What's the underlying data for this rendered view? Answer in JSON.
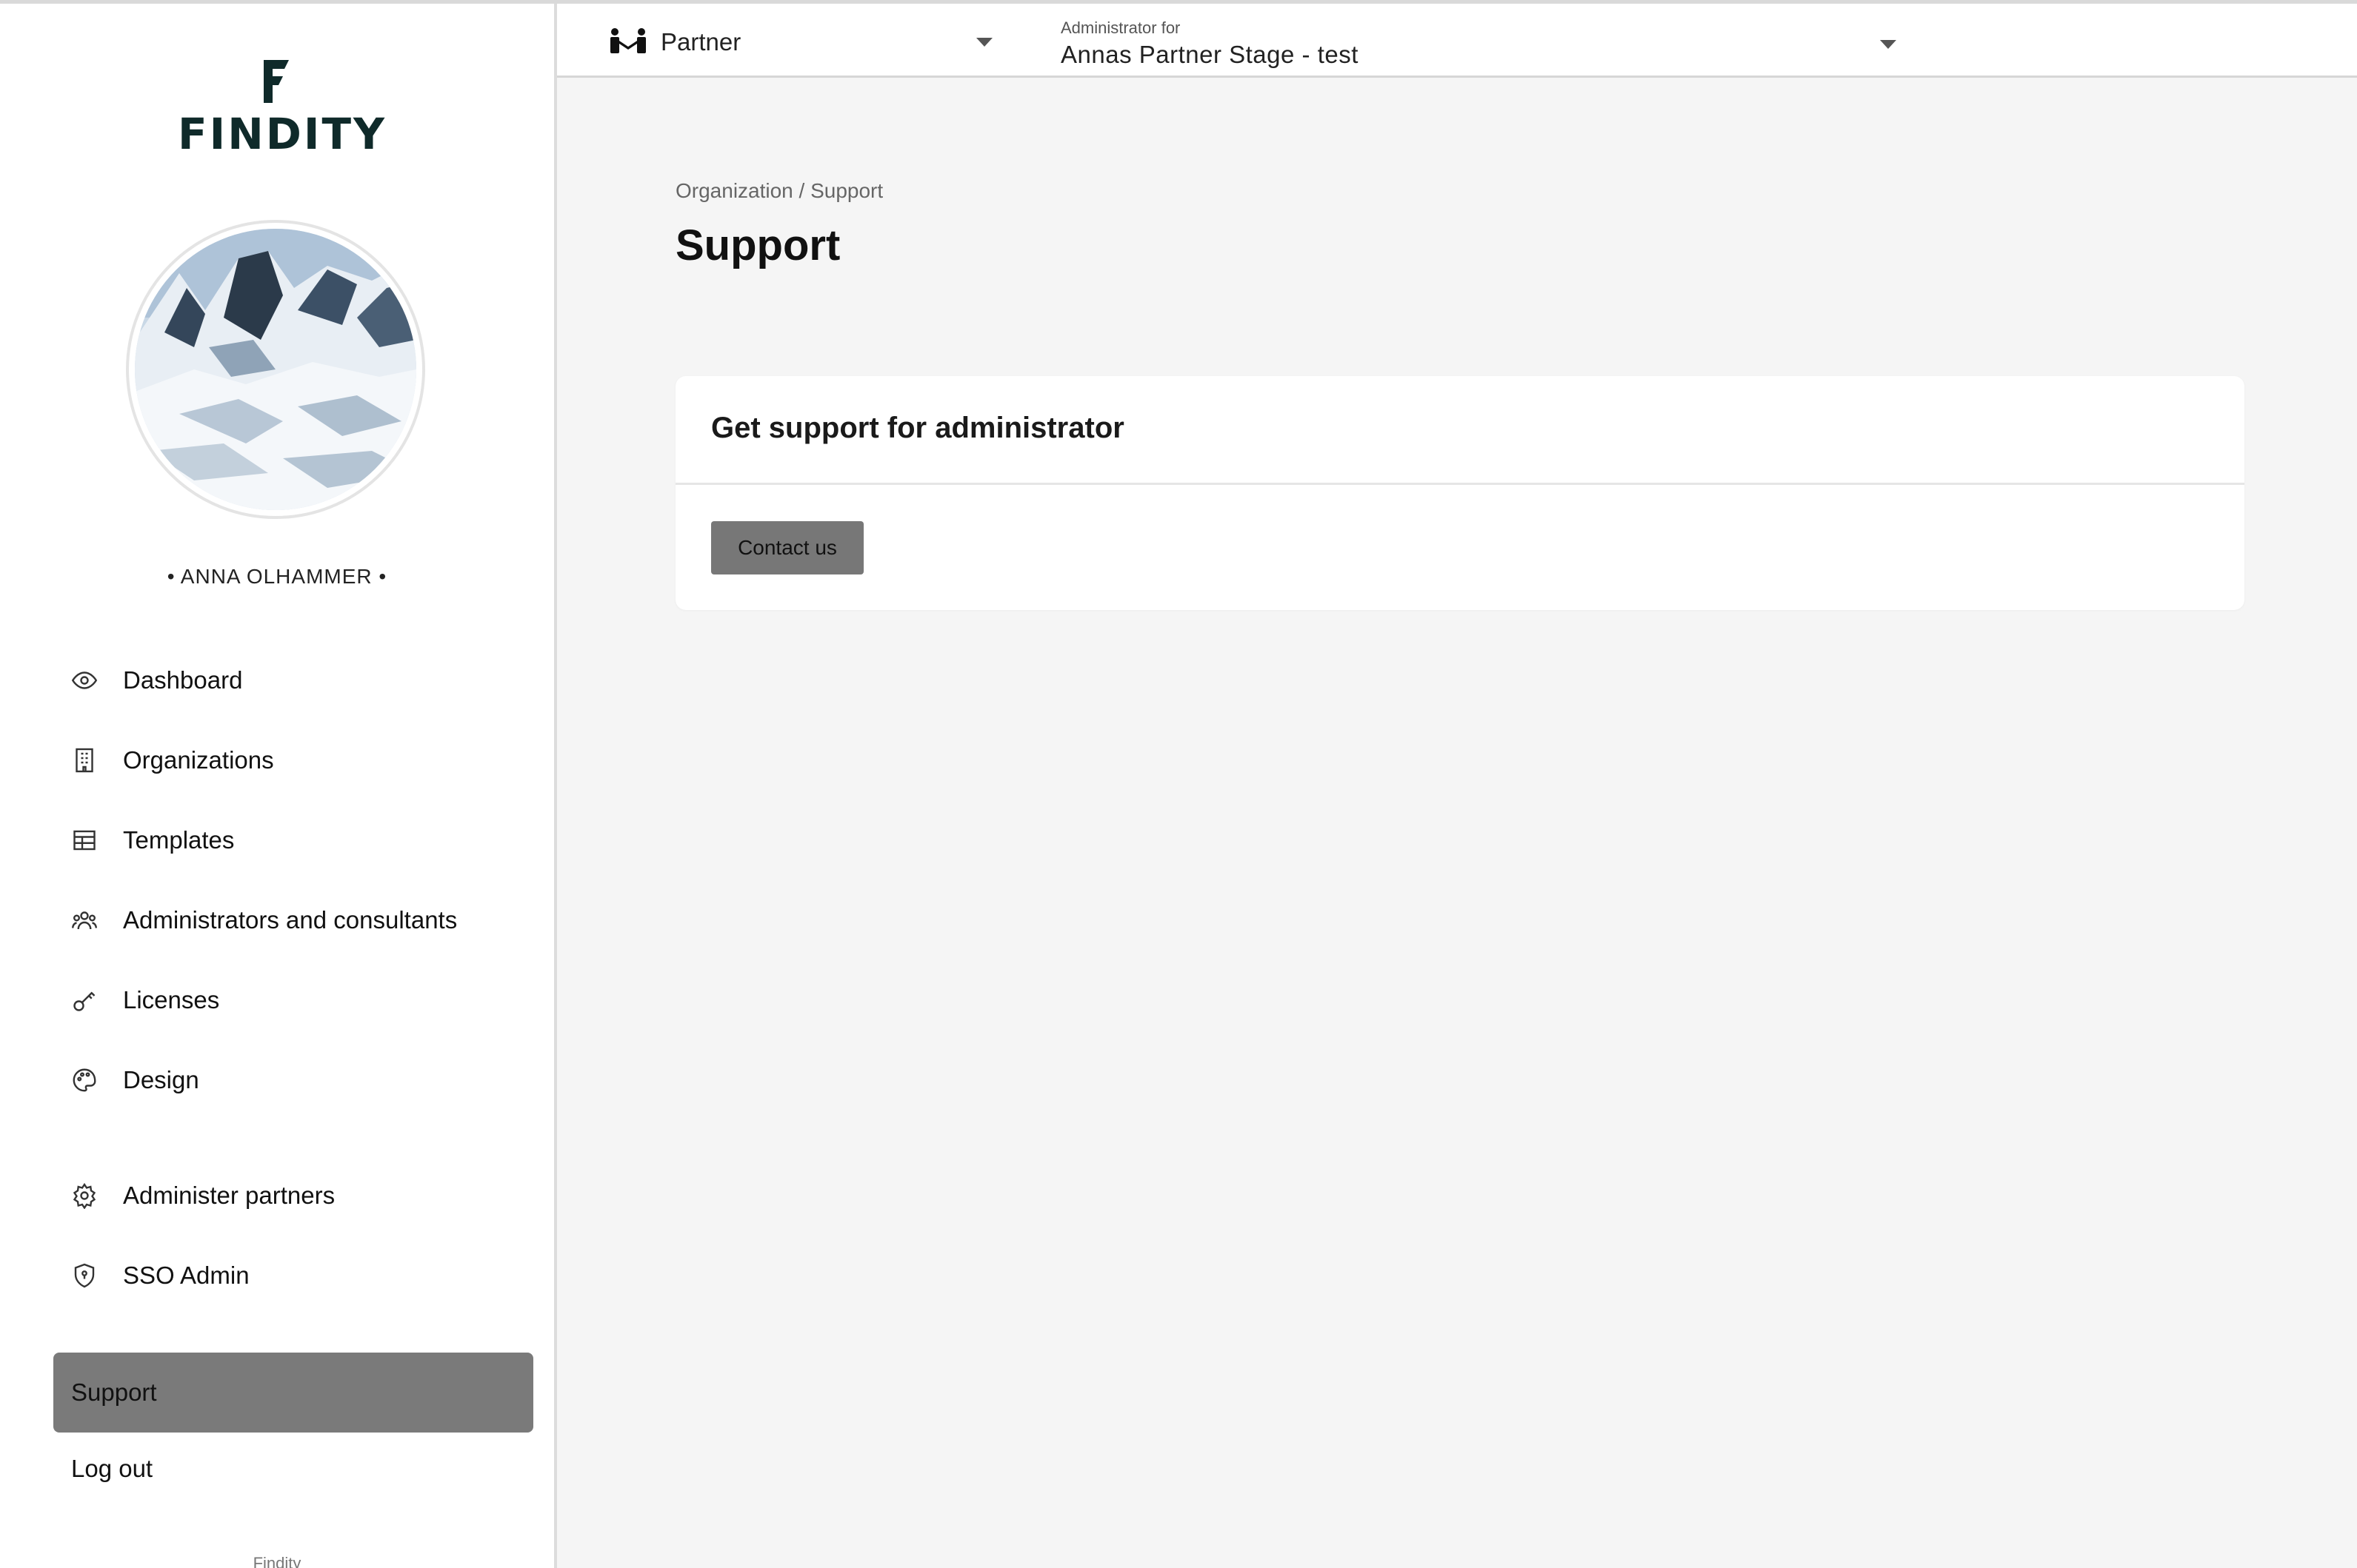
{
  "app": {
    "brand": "FINDITY",
    "footer": "Findity"
  },
  "header": {
    "partner_select": {
      "value": "Partner"
    },
    "org_select": {
      "label": "Administrator for",
      "value": "Annas Partner Stage - test"
    }
  },
  "user": {
    "name": "• ANNA OLHAMMER •"
  },
  "sidebar": {
    "items": [
      {
        "label": "Dashboard",
        "icon": "eye-icon"
      },
      {
        "label": "Organizations",
        "icon": "building-icon"
      },
      {
        "label": "Templates",
        "icon": "table-icon"
      },
      {
        "label": "Administrators and consultants",
        "icon": "users-icon"
      },
      {
        "label": "Licenses",
        "icon": "key-icon"
      },
      {
        "label": "Design",
        "icon": "palette-icon"
      },
      {
        "label": "Administer partners",
        "icon": "gear-icon"
      },
      {
        "label": "SSO Admin",
        "icon": "shield-icon"
      }
    ],
    "support": "Support",
    "logout": "Log out"
  },
  "main": {
    "breadcrumb": "Organization / Support",
    "title": "Support",
    "card": {
      "title": "Get support for administrator",
      "button": "Contact us"
    }
  },
  "colors": {
    "active_item": "#7a7a7a",
    "button": "#777777",
    "brand": "#0f2a2a"
  }
}
